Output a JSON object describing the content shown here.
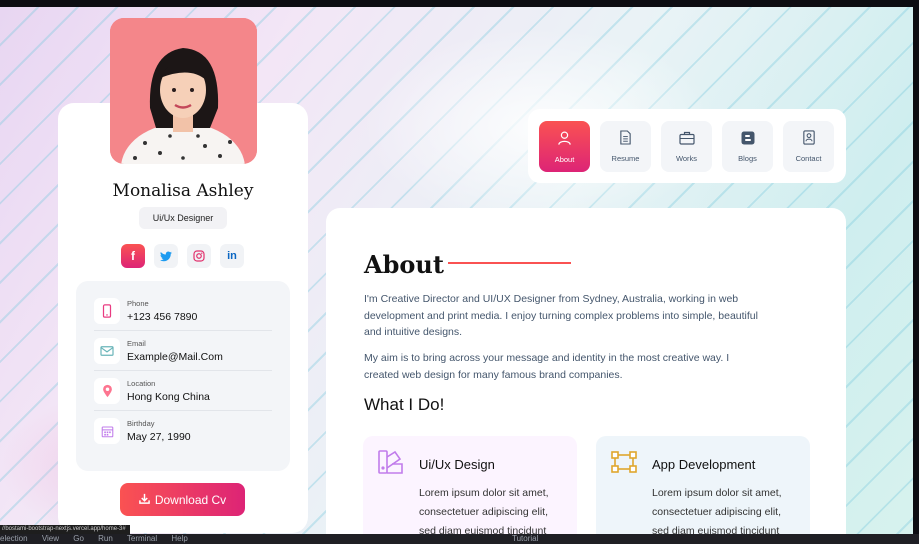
{
  "profile": {
    "name": "Monalisa Ashley",
    "role": "Ui/Ux Designer",
    "socials": [
      "facebook-icon",
      "twitter-icon",
      "instagram-icon",
      "linkedin-icon"
    ],
    "contacts": [
      {
        "label": "Phone",
        "value": "+123 456 7890",
        "icon": "phone-icon"
      },
      {
        "label": "Email",
        "value": "Example@Mail.Com",
        "icon": "email-icon"
      },
      {
        "label": "Location",
        "value": "Hong Kong China",
        "icon": "location-icon"
      },
      {
        "label": "Birthday",
        "value": "May 27, 1990",
        "icon": "calendar-icon"
      }
    ],
    "download_label": "Download Cv"
  },
  "nav": {
    "items": [
      {
        "label": "About",
        "icon": "user-icon",
        "active": true
      },
      {
        "label": "Resume",
        "icon": "document-icon",
        "active": false
      },
      {
        "label": "Works",
        "icon": "briefcase-icon",
        "active": false
      },
      {
        "label": "Blogs",
        "icon": "blogger-icon",
        "active": false
      },
      {
        "label": "Contact",
        "icon": "contact-card-icon",
        "active": false
      }
    ]
  },
  "about": {
    "title": "About",
    "para1": "I'm Creative Director and UI/UX Designer from Sydney, Australia, working in web development and print media. I enjoy turning complex problems into simple, beautiful and intuitive designs.",
    "para2": "My aim is to bring across your message and identity in the most creative way. I created web design for many famous brand companies.",
    "what_title": "What I Do!",
    "services": [
      {
        "title": "Ui/Ux Design",
        "text": "Lorem ipsum dolor sit amet, consectetuer adipiscing elit, sed diam euismod tincidunt"
      },
      {
        "title": "App Development",
        "text": "Lorem ipsum dolor sit amet, consectetuer adipiscing elit, sed diam euismod tincidunt"
      }
    ]
  },
  "browser": {
    "status_url": "//bostami-bootstrap-nextjs.vercel.app/home-3#"
  },
  "taskbar": {
    "items": [
      "election",
      "View",
      "Go",
      "Run",
      "Terminal",
      "Help"
    ],
    "center": "Tutorial"
  },
  "colors": {
    "accent_start": "#fa5252",
    "accent_end": "#dd2476",
    "text": "#44566c"
  }
}
